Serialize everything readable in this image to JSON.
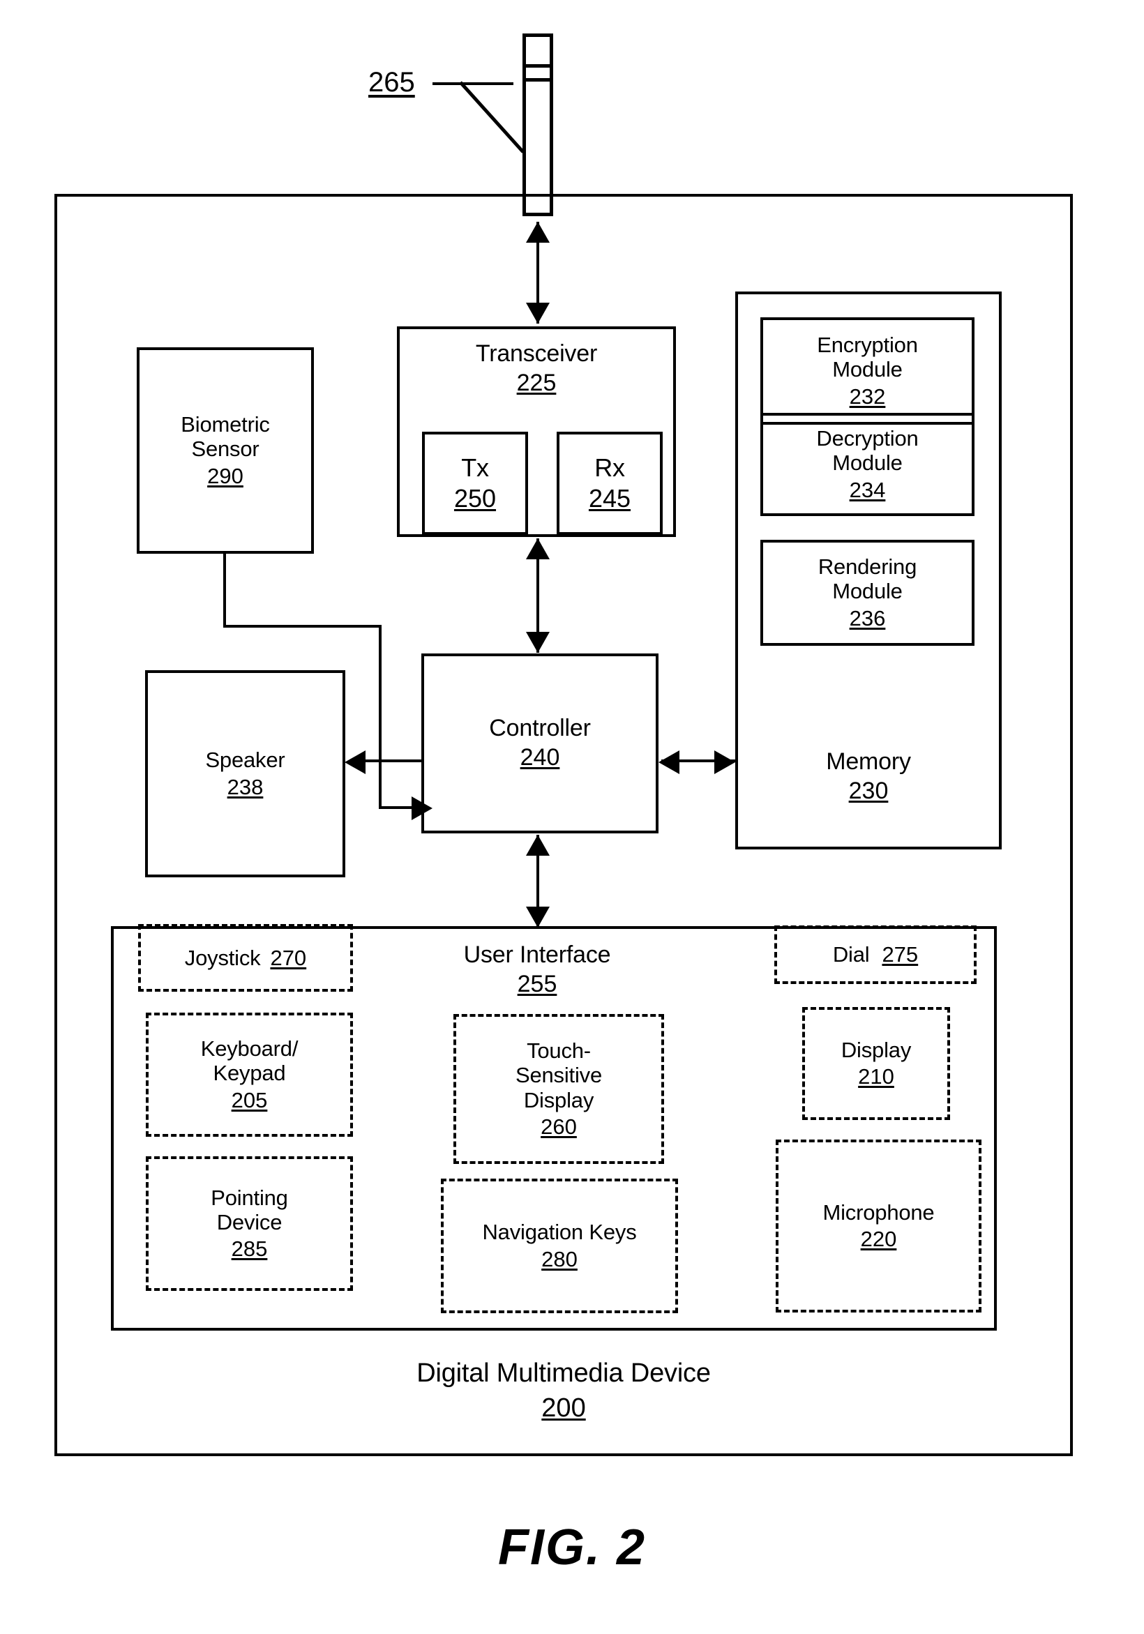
{
  "figure": {
    "caption": "FIG. 2",
    "antenna_ref": "265"
  },
  "device": {
    "label": "Digital Multimedia Device",
    "number": "200"
  },
  "transceiver": {
    "label": "Transceiver",
    "number": "225",
    "tx": {
      "label": "Tx",
      "number": "250"
    },
    "rx": {
      "label": "Rx",
      "number": "245"
    }
  },
  "biometric_sensor": {
    "label_line1": "Biometric",
    "label_line2": "Sensor",
    "number": "290"
  },
  "speaker": {
    "label": "Speaker",
    "number": "238"
  },
  "controller": {
    "label": "Controller",
    "number": "240"
  },
  "memory": {
    "label": "Memory",
    "number": "230",
    "modules": [
      {
        "label_line1": "Encryption",
        "label_line2": "Module",
        "number": "232"
      },
      {
        "label_line1": "Decryption",
        "label_line2": "Module",
        "number": "234"
      },
      {
        "label_line1": "Rendering",
        "label_line2": "Module",
        "number": "236"
      }
    ]
  },
  "user_interface": {
    "label": "User Interface",
    "number": "255",
    "joystick": {
      "label": "Joystick",
      "number": "270"
    },
    "keyboard": {
      "label_line1": "Keyboard/",
      "label_line2": "Keypad",
      "number": "205"
    },
    "pointing_device": {
      "label_line1": "Pointing",
      "label_line2": "Device",
      "number": "285"
    },
    "touch_display": {
      "label_line1": "Touch-",
      "label_line2": "Sensitive",
      "label_line3": "Display",
      "number": "260"
    },
    "navigation_keys": {
      "label": "Navigation Keys",
      "number": "280"
    },
    "dial": {
      "label": "Dial",
      "number": "275"
    },
    "display": {
      "label": "Display",
      "number": "210"
    },
    "microphone": {
      "label": "Microphone",
      "number": "220"
    }
  },
  "colors": {
    "line": "#000000",
    "background": "#ffffff"
  }
}
